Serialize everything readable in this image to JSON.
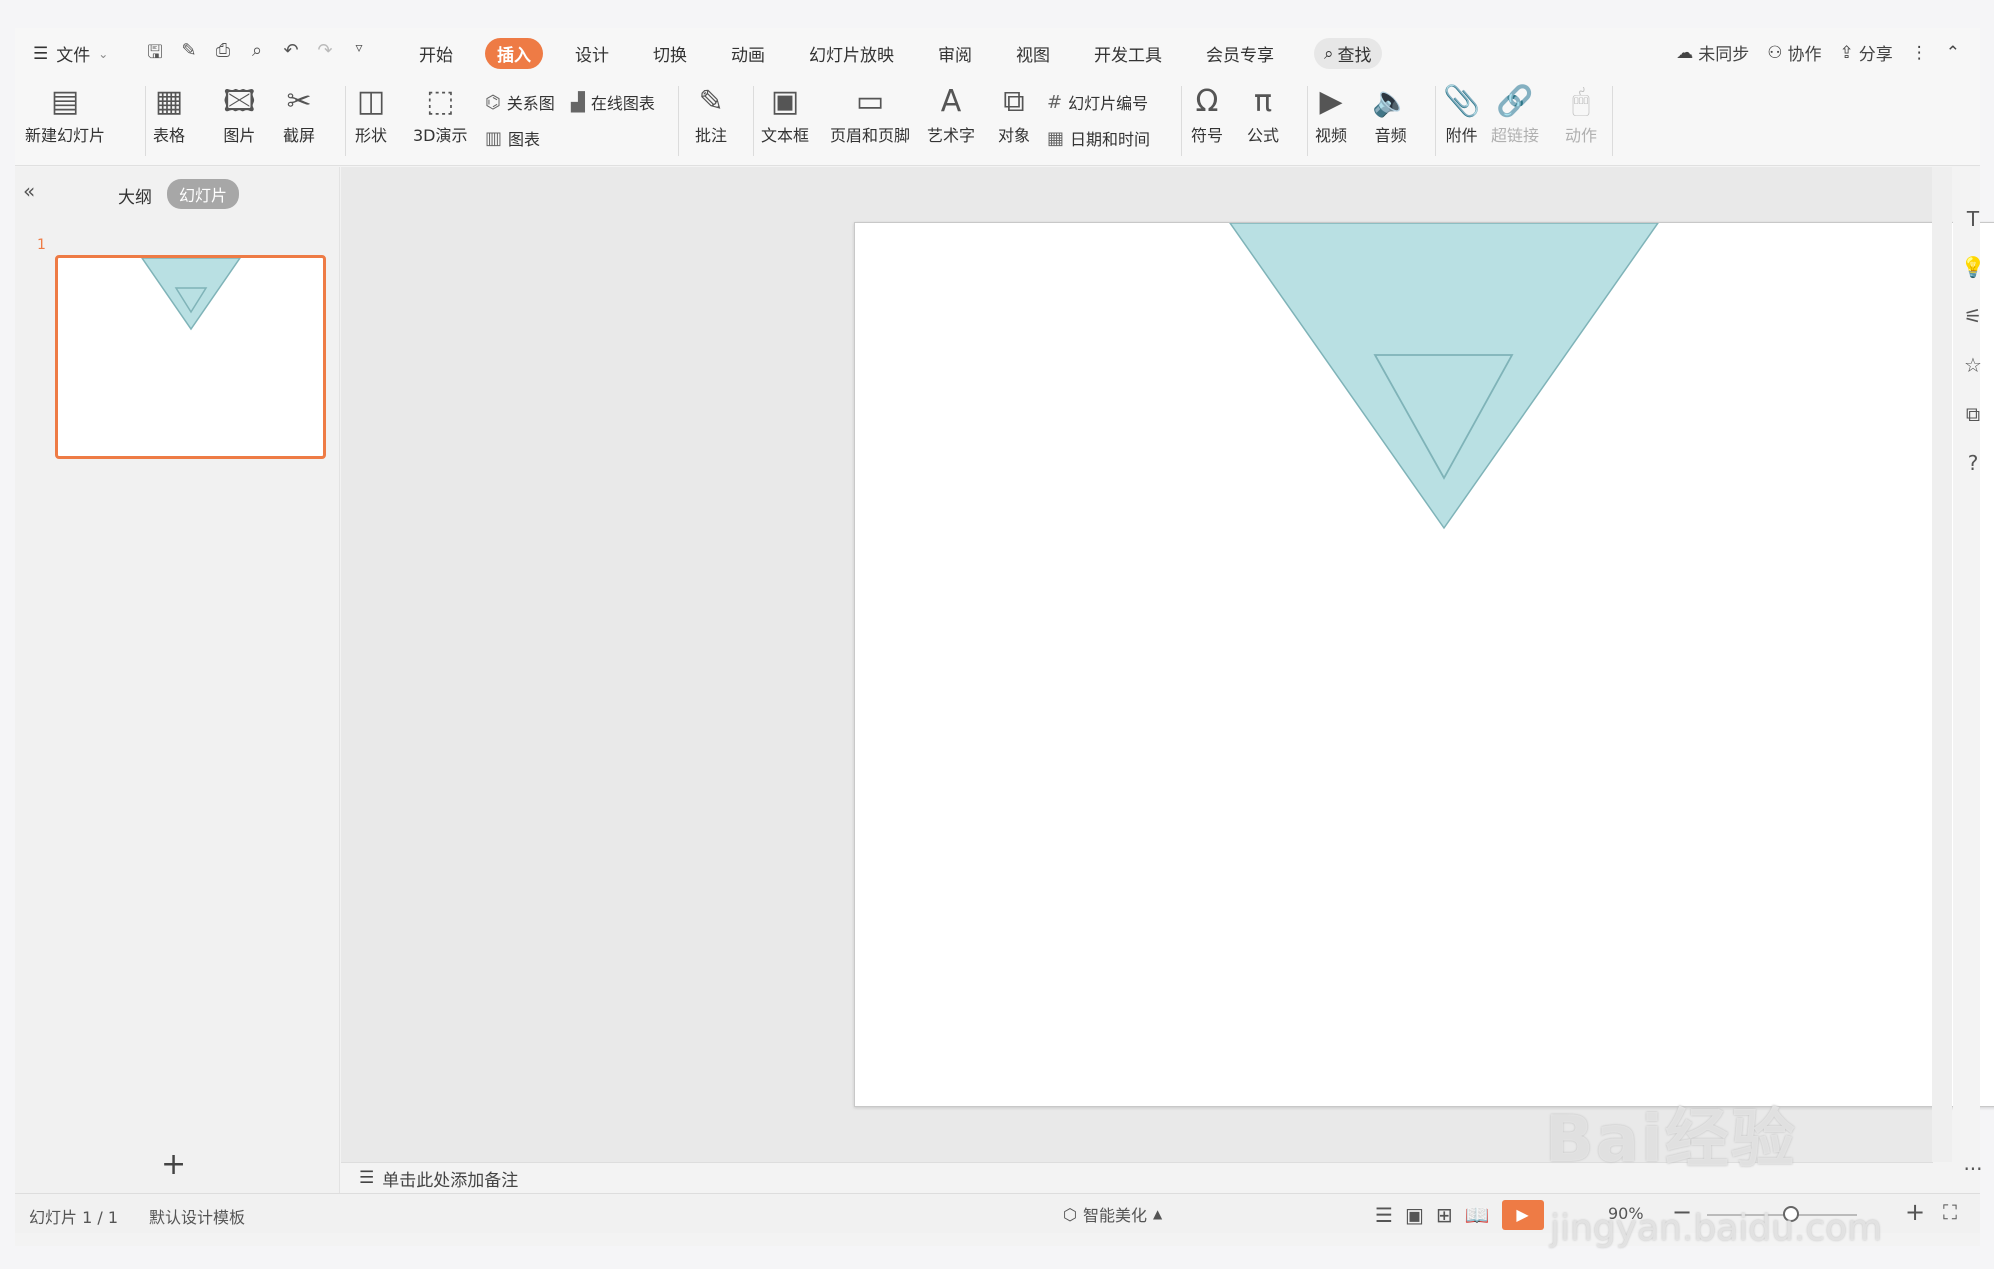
{
  "menubar": {
    "file": "文件",
    "tabs": [
      "开始",
      "插入",
      "设计",
      "切换",
      "动画",
      "幻灯片放映",
      "审阅",
      "视图",
      "开发工具",
      "会员专享"
    ],
    "active_tab": "插入",
    "search": "查找",
    "right": {
      "sync": "未同步",
      "collab": "协作",
      "share": "分享"
    }
  },
  "ribbon": {
    "new_slide": "新建幻灯片",
    "table": "表格",
    "picture": "图片",
    "screenshot": "截屏",
    "shape": "形状",
    "demo3d": "3D演示",
    "relation": "关系图",
    "online_chart": "在线图表",
    "chart": "图表",
    "comment": "批注",
    "textbox": "文本框",
    "header_footer": "页眉和页脚",
    "wordart": "艺术字",
    "object": "对象",
    "slide_number": "幻灯片编号",
    "datetime": "日期和时间",
    "symbol": "符号",
    "formula": "公式",
    "video": "视频",
    "audio": "音频",
    "attachment": "附件",
    "hyperlink": "超链接",
    "action": "动作"
  },
  "panel": {
    "outline": "大纲",
    "slides": "幻灯片",
    "slide_number": "1"
  },
  "notes": {
    "placeholder": "单击此处添加备注"
  },
  "status": {
    "slide_info": "幻灯片 1 / 1",
    "template": "默认设计模板",
    "beautify": "智能美化",
    "zoom": "90%"
  },
  "watermark": {
    "brand": "Bai经验",
    "url": "jingyan.baidu.com"
  },
  "colors": {
    "accent": "#ee7b45",
    "triangle_fill": "#b9e0e3",
    "triangle_stroke": "#7fb3b8"
  }
}
